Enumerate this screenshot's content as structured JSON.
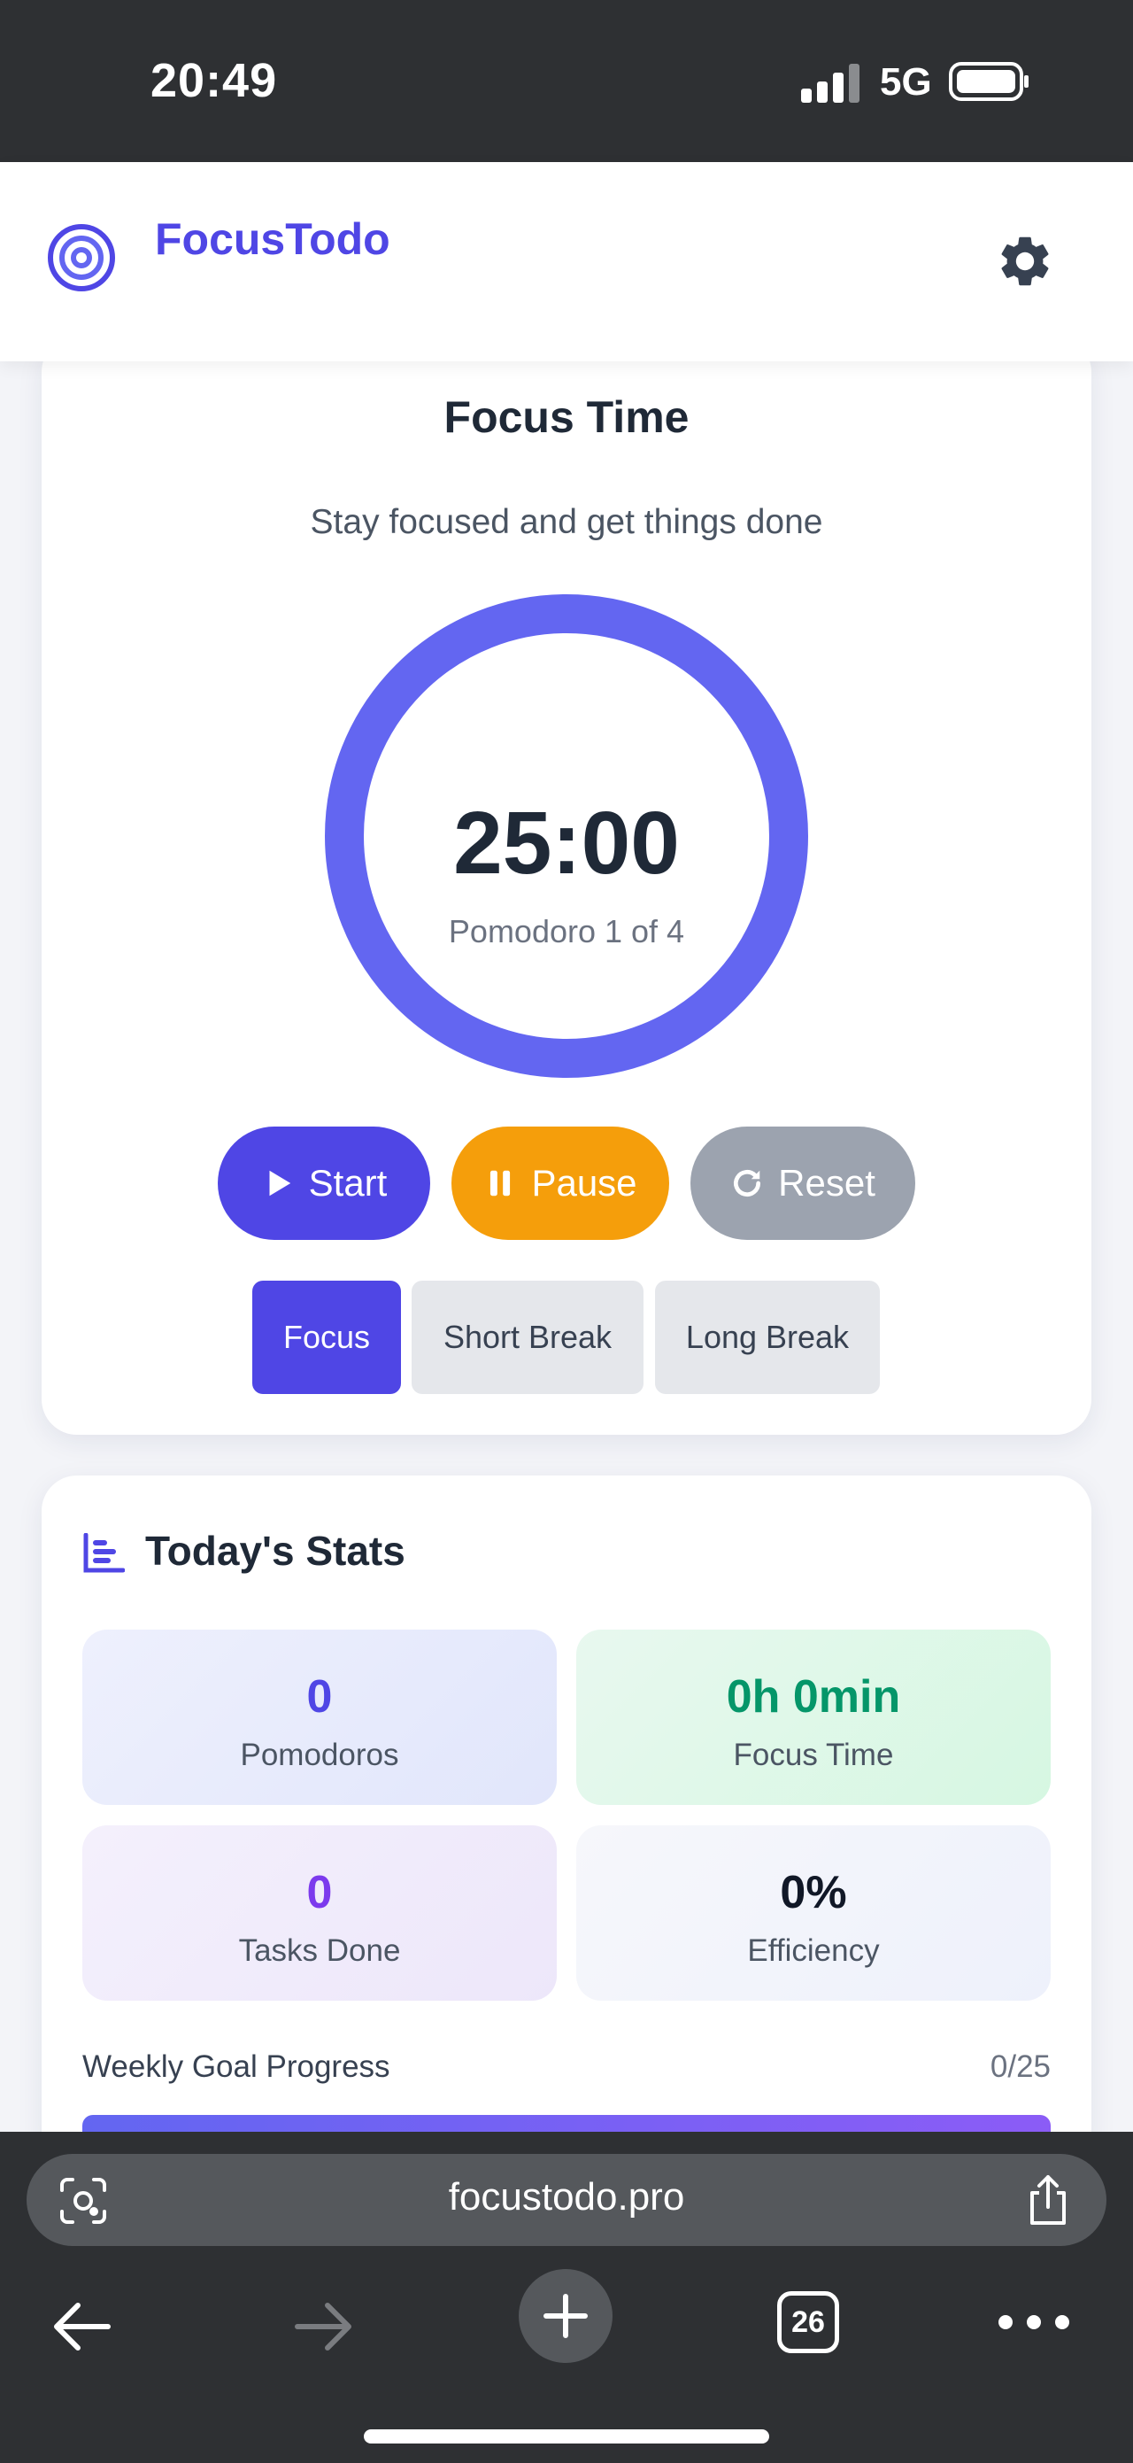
{
  "status_bar": {
    "time": "20:49",
    "network": "5G"
  },
  "header": {
    "brand": "FocusTodo"
  },
  "timer": {
    "title": "Focus Time",
    "subtitle": "Stay focused and get things done",
    "time": "25:00",
    "session": "Pomodoro 1 of 4",
    "start_label": "Start",
    "pause_label": "Pause",
    "reset_label": "Reset",
    "modes": [
      "Focus",
      "Short Break",
      "Long Break"
    ],
    "active_mode": "Focus"
  },
  "stats": {
    "title": "Today's Stats",
    "tiles": [
      {
        "value": "0",
        "label": "Pomodoros",
        "color": "#4f46e5"
      },
      {
        "value": "0h 0min",
        "label": "Focus Time",
        "color": "#059669"
      },
      {
        "value": "0",
        "label": "Tasks Done",
        "color": "#7c3aed"
      },
      {
        "value": "0%",
        "label": "Efficiency",
        "color": "#111827"
      }
    ],
    "goal_label": "Weekly Goal Progress",
    "goal_count": "0/25"
  },
  "browser": {
    "url": "focustodo.pro",
    "tab_count": "26"
  },
  "colors": {
    "accent": "#4f46e5",
    "pause": "#f59e0b",
    "reset": "#9ca3af",
    "ring": "#6366f1"
  }
}
